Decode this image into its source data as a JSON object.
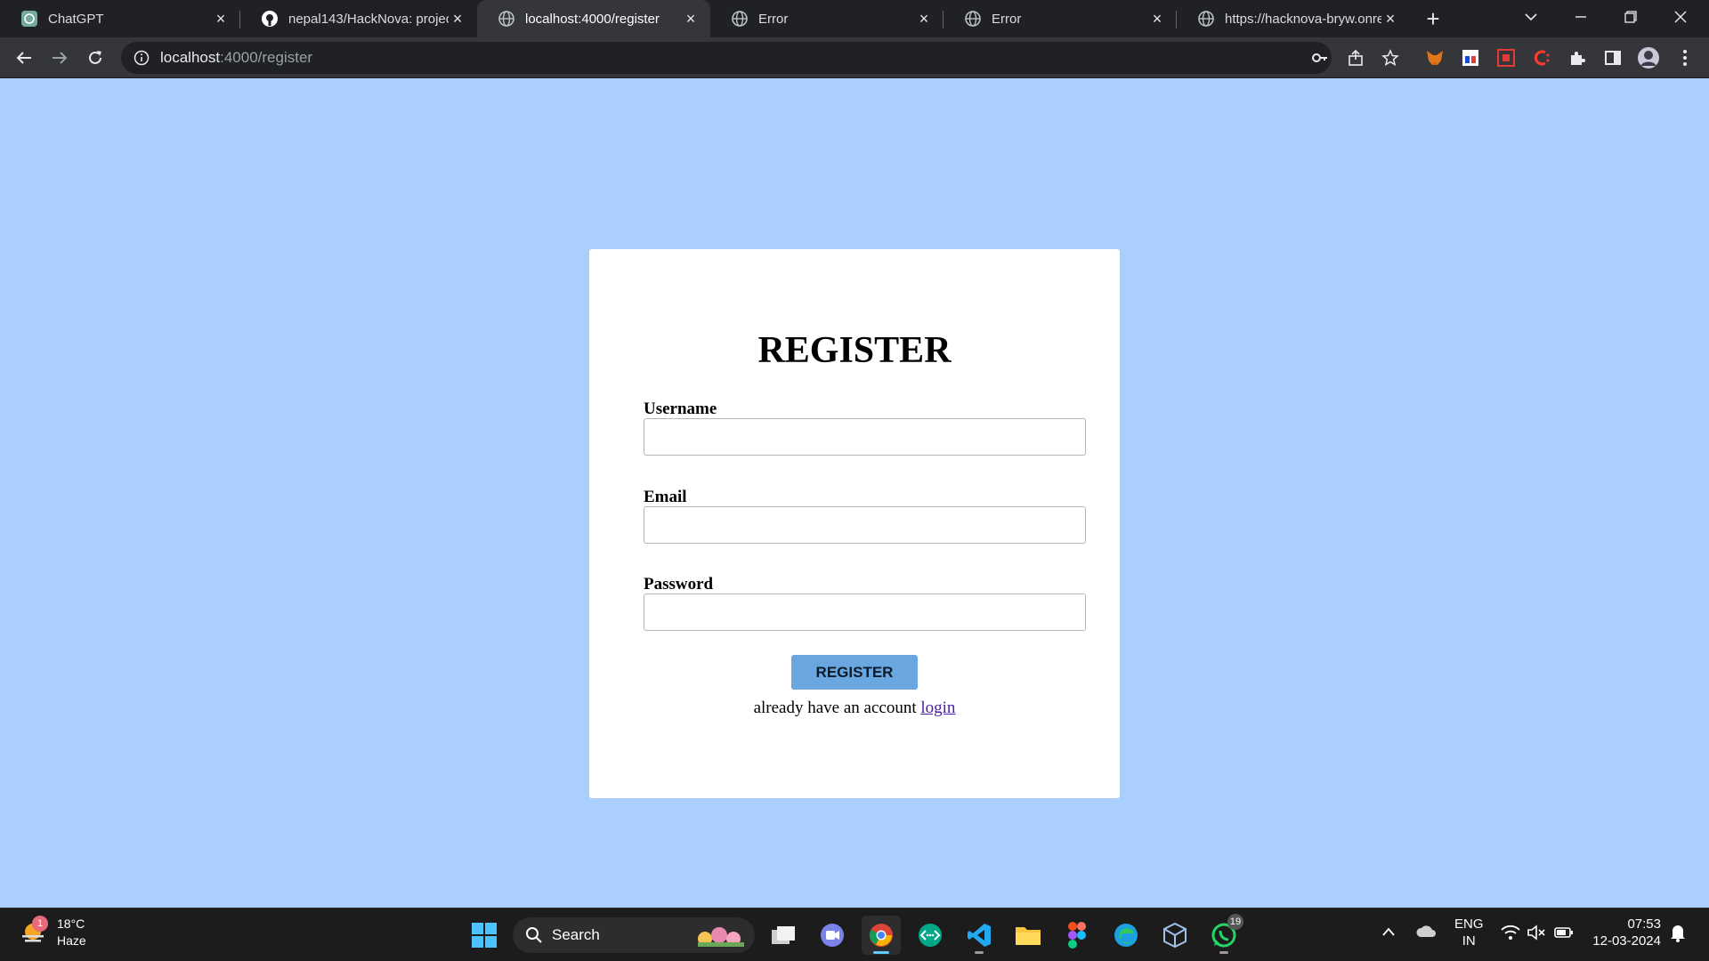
{
  "browser": {
    "tabs": [
      {
        "title": "ChatGPT",
        "icon": "chatgpt-icon"
      },
      {
        "title": "nepal143/HackNova: projec",
        "icon": "github-icon"
      },
      {
        "title": "localhost:4000/register",
        "icon": "globe-icon"
      },
      {
        "title": "Error",
        "icon": "globe-icon"
      },
      {
        "title": "Error",
        "icon": "globe-icon"
      },
      {
        "title": "https://hacknova-bryw.onre",
        "icon": "globe-icon"
      }
    ],
    "active_tab": 2,
    "url_host": "localhost",
    "url_path": ":4000/register"
  },
  "page": {
    "background": "#aacffd",
    "title": "REGISTER",
    "fields": {
      "username_label": "Username",
      "email_label": "Email",
      "password_label": "Password"
    },
    "button_label": "REGISTER",
    "footer_text": "already have an account",
    "login_link": "login"
  },
  "taskbar": {
    "weather_temp": "18°C",
    "weather_desc": "Haze",
    "weather_badge": "1",
    "search_placeholder": "Search",
    "whatsapp_badge": "19",
    "lang_line1": "ENG",
    "lang_line2": "IN",
    "time": "07:53",
    "date": "12-03-2024"
  }
}
